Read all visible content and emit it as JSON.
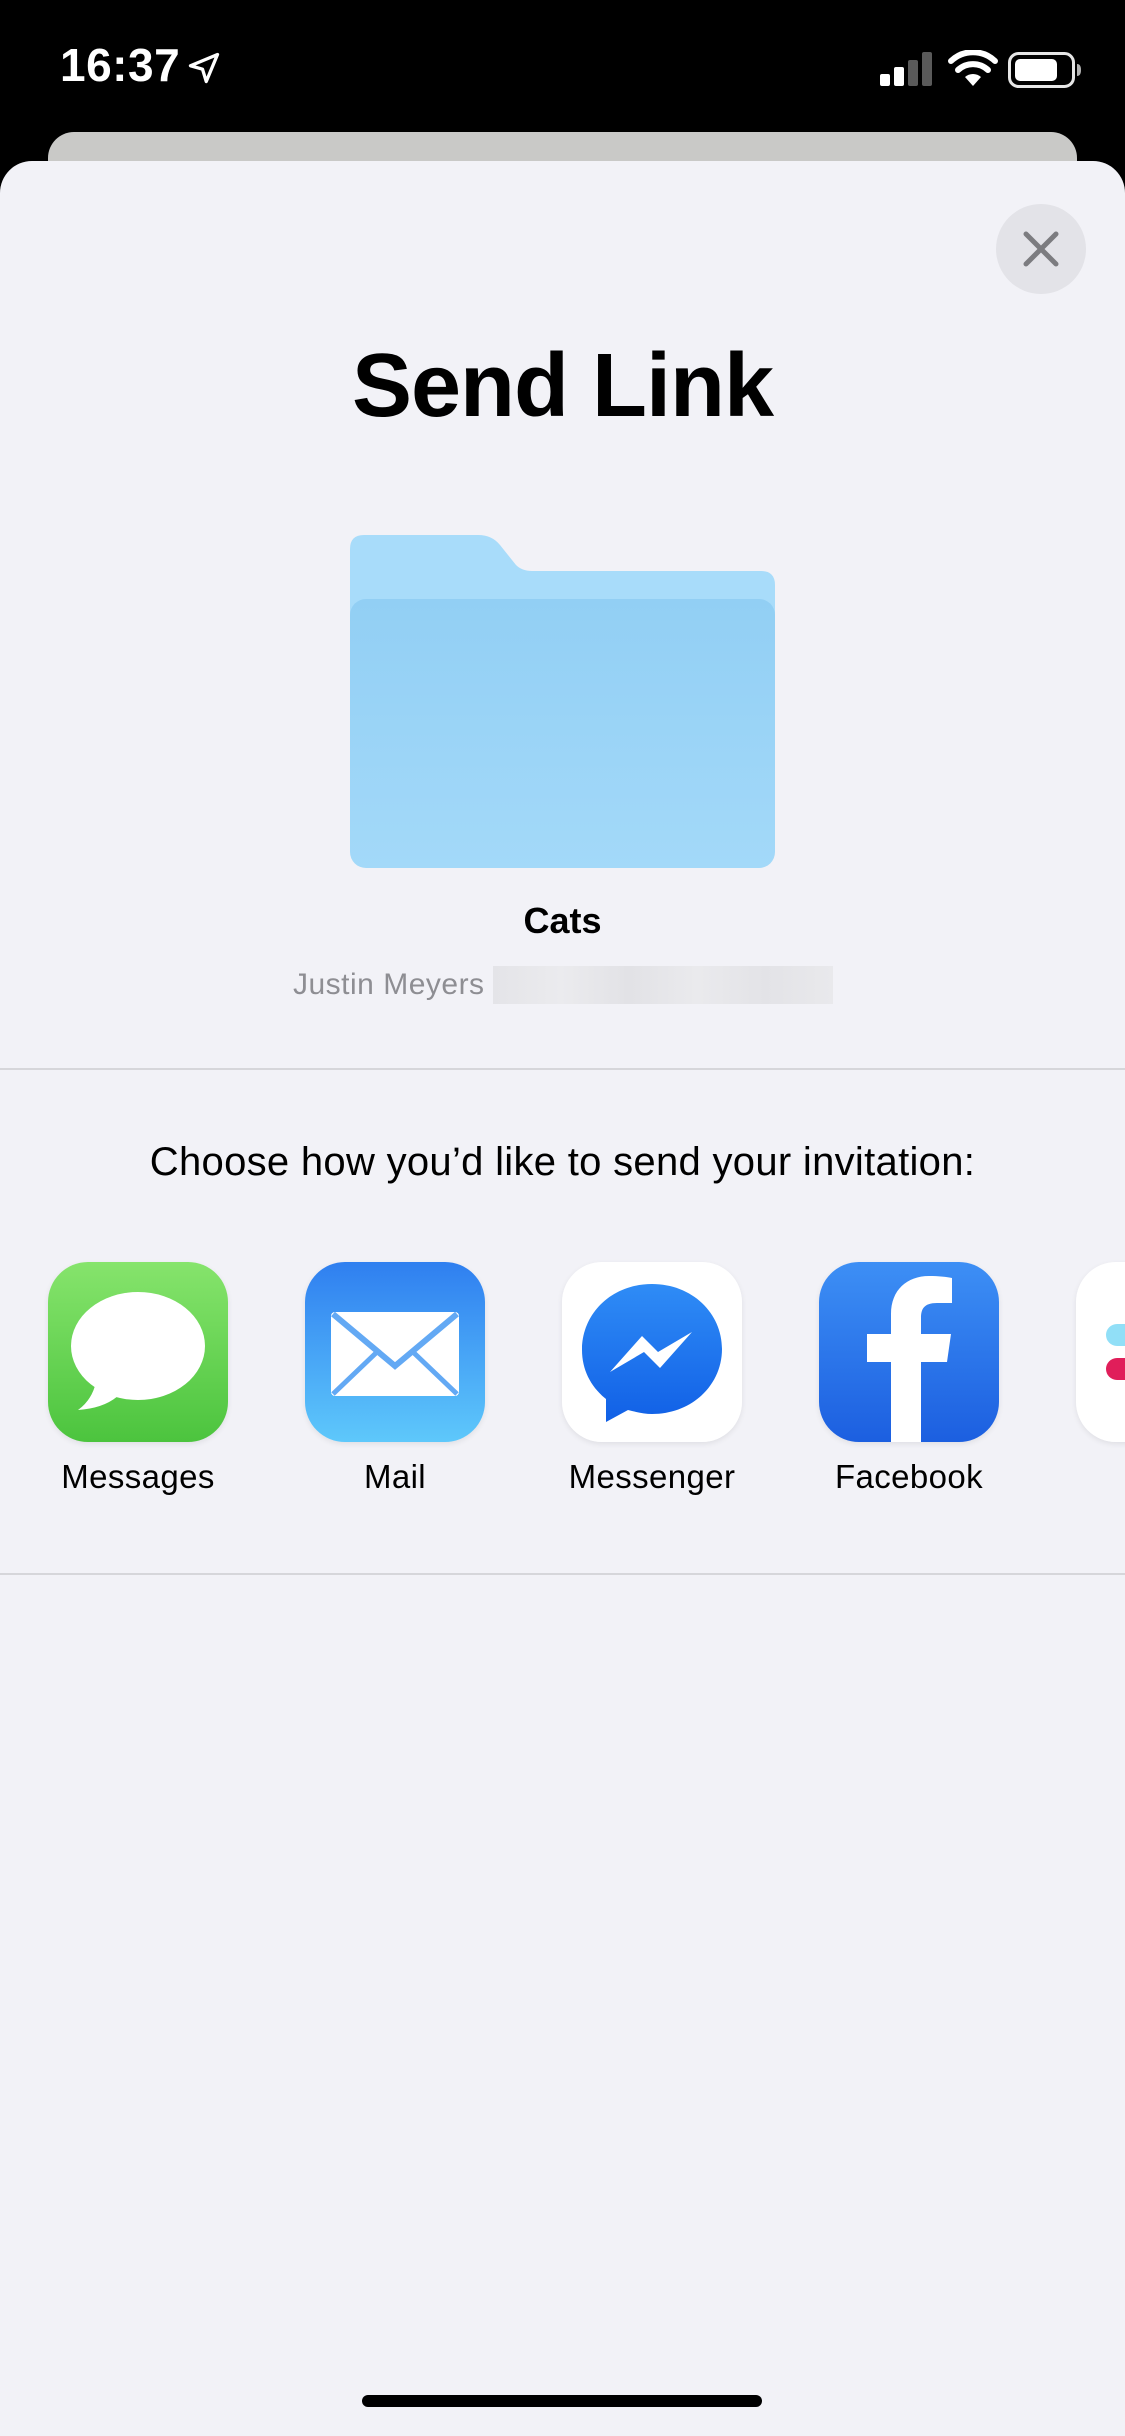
{
  "status_bar": {
    "time": "16:37",
    "location_icon": "location-arrow-icon",
    "signal_icon": "cellular-signal-icon",
    "wifi_icon": "wifi-icon",
    "battery_icon": "battery-icon"
  },
  "sheet": {
    "title": "Send Link",
    "close_icon": "close-icon",
    "folder": {
      "icon": "folder-icon",
      "name": "Cats",
      "owner": "Justin Meyers"
    },
    "prompt": "Choose how you’d like to send your invitation:",
    "apps": [
      {
        "label": "Messages",
        "icon": "messages-icon",
        "color": "#4cd964"
      },
      {
        "label": "Mail",
        "icon": "mail-icon",
        "color": "#2f9af5"
      },
      {
        "label": "Messenger",
        "icon": "messenger-icon",
        "color": "#0a7cff"
      },
      {
        "label": "Facebook",
        "icon": "facebook-icon",
        "color": "#1877f2"
      },
      {
        "label": "",
        "icon": "slack-icon",
        "color": "#e01e5a"
      }
    ]
  },
  "colors": {
    "sheet_background": "#f2f2f7",
    "folder_blue": "#a7daf8",
    "secondary_text": "#8e8e93"
  }
}
